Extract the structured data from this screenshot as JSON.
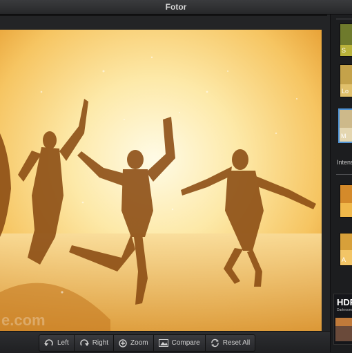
{
  "window": {
    "title": "Fotor"
  },
  "watermark": "e.com",
  "toolbar": {
    "left": "Left",
    "right": "Right",
    "zoom": "Zoom",
    "compare": "Compare",
    "reset_all": "Reset All"
  },
  "sidebar": {
    "effects": [
      {
        "label": "S",
        "color": "#6e7a2c"
      },
      {
        "label": "Lo",
        "color": "#c4a24a"
      },
      {
        "label": "M",
        "color": "#cdb98a",
        "selected": true
      },
      {
        "label": "",
        "color": "#d48a2a"
      },
      {
        "label": "A",
        "color": "#d7a03a"
      }
    ],
    "intensity_label": "Intens",
    "hdr": {
      "title": "HDR",
      "subtitle": "Darkroom"
    }
  }
}
